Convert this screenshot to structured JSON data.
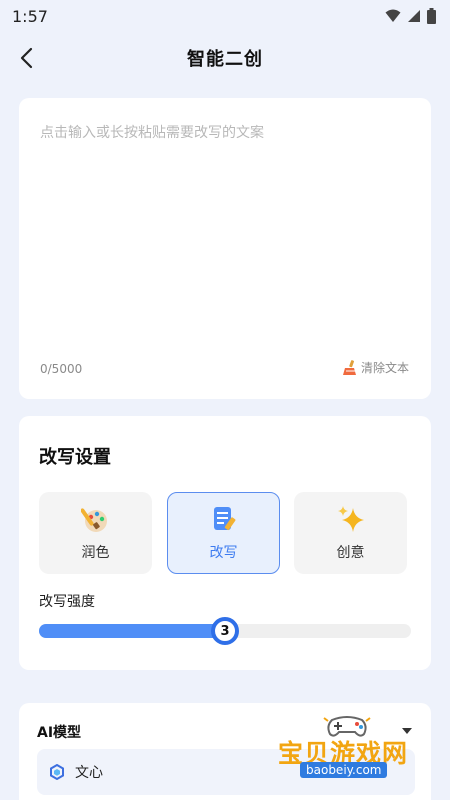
{
  "status_bar": {
    "time": "1:57"
  },
  "header": {
    "title": "智能二创"
  },
  "input": {
    "placeholder": "点击输入或长按粘贴需要改写的文案",
    "char_count": "0/5000",
    "clear_label": "清除文本"
  },
  "settings": {
    "title": "改写设置",
    "modes": [
      {
        "label": "润色",
        "icon": "paintbrush-icon",
        "active": false
      },
      {
        "label": "改写",
        "icon": "document-edit-icon",
        "active": true
      },
      {
        "label": "创意",
        "icon": "sparkles-icon",
        "active": false
      }
    ],
    "strength_label": "改写强度",
    "strength": {
      "value": "3",
      "fraction": 0.5
    }
  },
  "model": {
    "title": "AI模型",
    "selected": "文心"
  },
  "watermark": {
    "text": "宝贝游戏网",
    "url": "baobeiy.com"
  },
  "colors": {
    "accent": "#4f8ef7",
    "background": "#eef2fb"
  }
}
